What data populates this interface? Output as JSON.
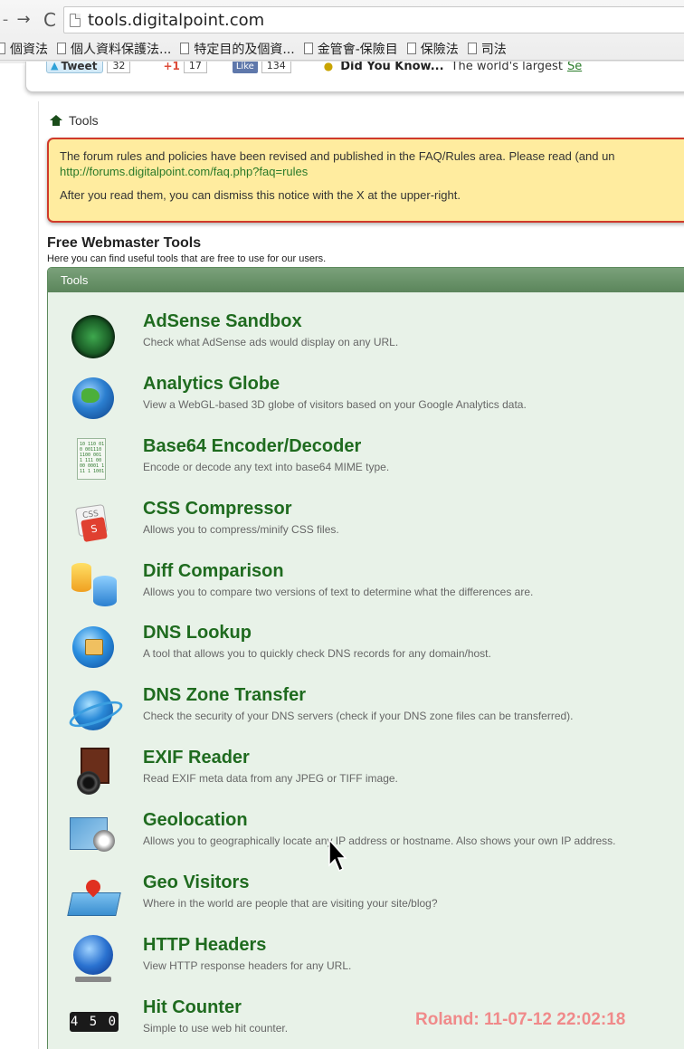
{
  "browser": {
    "url": "tools.digitalpoint.com",
    "bookmarks": [
      "個資法",
      "個人資料保護法...",
      "特定目的及個資...",
      "金管會-保險目",
      "保險法",
      "司法"
    ]
  },
  "share_bar": {
    "tweet_label": "Tweet",
    "tweet_count": "32",
    "gplus_label": "+1",
    "gplus_count": "17",
    "fb_label": "Like",
    "fb_count": "134",
    "dyk_title": "Did You Know...",
    "dyk_text": "The world's largest",
    "dyk_link": "Se"
  },
  "breadcrumb": {
    "label": "Tools"
  },
  "notice": {
    "line1": "The forum rules and policies have been revised and published in the FAQ/Rules area. Please read (and un",
    "url": "http://forums.digitalpoint.com/faq.php?faq=rules",
    "line2": "After you read them, you can dismiss this notice with the X at the upper-right."
  },
  "section": {
    "title": "Free Webmaster Tools",
    "subtitle": "Here you can find useful tools that are free to use for our users."
  },
  "tools_header": "Tools",
  "tools": [
    {
      "name": "AdSense Sandbox",
      "desc": "Check what AdSense ads would display on any URL.",
      "icon": "radar-icon"
    },
    {
      "name": "Analytics Globe",
      "desc": "View a WebGL-based 3D globe of visitors based on your Google Analytics data.",
      "icon": "globe-icon"
    },
    {
      "name": "Base64 Encoder/Decoder",
      "desc": "Encode or decode any text into base64 MIME type.",
      "icon": "binary-document-icon"
    },
    {
      "name": "CSS Compressor",
      "desc": "Allows you to compress/minify CSS files.",
      "icon": "css-file-icon"
    },
    {
      "name": "Diff Comparison",
      "desc": "Allows you to compare two versions of text to determine what the differences are.",
      "icon": "database-compare-icon"
    },
    {
      "name": "DNS Lookup",
      "desc": "A tool that allows you to quickly check DNS records for any domain/host.",
      "icon": "network-globe-icon"
    },
    {
      "name": "DNS Zone Transfer",
      "desc": "Check the security of your DNS servers (check if your DNS zone files can be transferred).",
      "icon": "orbit-globe-icon"
    },
    {
      "name": "EXIF Reader",
      "desc": "Read EXIF meta data from any JPEG or TIFF image.",
      "icon": "camera-icon"
    },
    {
      "name": "Geolocation",
      "desc": "Allows you to geographically locate any IP address or hostname. Also shows your own IP address.",
      "icon": "map-compass-icon"
    },
    {
      "name": "Geo Visitors",
      "desc": "Where in the world are people that are visiting your site/blog?",
      "icon": "map-pin-icon"
    },
    {
      "name": "HTTP Headers",
      "desc": "View HTTP response headers for any URL.",
      "icon": "server-globe-icon"
    },
    {
      "name": "Hit Counter",
      "desc": "Simple to use web hit counter.",
      "icon": "counter-icon",
      "counter_digits": "4 5 0"
    }
  ],
  "watermark": "Roland: 11-07-12 22:02:18"
}
